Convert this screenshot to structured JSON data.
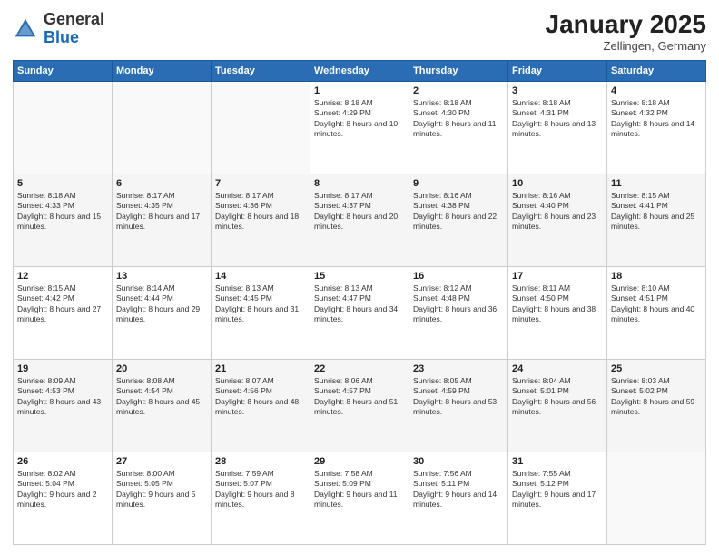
{
  "header": {
    "logo_general": "General",
    "logo_blue": "Blue",
    "title": "January 2025",
    "subtitle": "Zellingen, Germany"
  },
  "weekdays": [
    "Sunday",
    "Monday",
    "Tuesday",
    "Wednesday",
    "Thursday",
    "Friday",
    "Saturday"
  ],
  "weeks": [
    [
      {
        "day": "",
        "sunrise": "",
        "sunset": "",
        "daylight": ""
      },
      {
        "day": "",
        "sunrise": "",
        "sunset": "",
        "daylight": ""
      },
      {
        "day": "",
        "sunrise": "",
        "sunset": "",
        "daylight": ""
      },
      {
        "day": "1",
        "sunrise": "Sunrise: 8:18 AM",
        "sunset": "Sunset: 4:29 PM",
        "daylight": "Daylight: 8 hours and 10 minutes."
      },
      {
        "day": "2",
        "sunrise": "Sunrise: 8:18 AM",
        "sunset": "Sunset: 4:30 PM",
        "daylight": "Daylight: 8 hours and 11 minutes."
      },
      {
        "day": "3",
        "sunrise": "Sunrise: 8:18 AM",
        "sunset": "Sunset: 4:31 PM",
        "daylight": "Daylight: 8 hours and 13 minutes."
      },
      {
        "day": "4",
        "sunrise": "Sunrise: 8:18 AM",
        "sunset": "Sunset: 4:32 PM",
        "daylight": "Daylight: 8 hours and 14 minutes."
      }
    ],
    [
      {
        "day": "5",
        "sunrise": "Sunrise: 8:18 AM",
        "sunset": "Sunset: 4:33 PM",
        "daylight": "Daylight: 8 hours and 15 minutes."
      },
      {
        "day": "6",
        "sunrise": "Sunrise: 8:17 AM",
        "sunset": "Sunset: 4:35 PM",
        "daylight": "Daylight: 8 hours and 17 minutes."
      },
      {
        "day": "7",
        "sunrise": "Sunrise: 8:17 AM",
        "sunset": "Sunset: 4:36 PM",
        "daylight": "Daylight: 8 hours and 18 minutes."
      },
      {
        "day": "8",
        "sunrise": "Sunrise: 8:17 AM",
        "sunset": "Sunset: 4:37 PM",
        "daylight": "Daylight: 8 hours and 20 minutes."
      },
      {
        "day": "9",
        "sunrise": "Sunrise: 8:16 AM",
        "sunset": "Sunset: 4:38 PM",
        "daylight": "Daylight: 8 hours and 22 minutes."
      },
      {
        "day": "10",
        "sunrise": "Sunrise: 8:16 AM",
        "sunset": "Sunset: 4:40 PM",
        "daylight": "Daylight: 8 hours and 23 minutes."
      },
      {
        "day": "11",
        "sunrise": "Sunrise: 8:15 AM",
        "sunset": "Sunset: 4:41 PM",
        "daylight": "Daylight: 8 hours and 25 minutes."
      }
    ],
    [
      {
        "day": "12",
        "sunrise": "Sunrise: 8:15 AM",
        "sunset": "Sunset: 4:42 PM",
        "daylight": "Daylight: 8 hours and 27 minutes."
      },
      {
        "day": "13",
        "sunrise": "Sunrise: 8:14 AM",
        "sunset": "Sunset: 4:44 PM",
        "daylight": "Daylight: 8 hours and 29 minutes."
      },
      {
        "day": "14",
        "sunrise": "Sunrise: 8:13 AM",
        "sunset": "Sunset: 4:45 PM",
        "daylight": "Daylight: 8 hours and 31 minutes."
      },
      {
        "day": "15",
        "sunrise": "Sunrise: 8:13 AM",
        "sunset": "Sunset: 4:47 PM",
        "daylight": "Daylight: 8 hours and 34 minutes."
      },
      {
        "day": "16",
        "sunrise": "Sunrise: 8:12 AM",
        "sunset": "Sunset: 4:48 PM",
        "daylight": "Daylight: 8 hours and 36 minutes."
      },
      {
        "day": "17",
        "sunrise": "Sunrise: 8:11 AM",
        "sunset": "Sunset: 4:50 PM",
        "daylight": "Daylight: 8 hours and 38 minutes."
      },
      {
        "day": "18",
        "sunrise": "Sunrise: 8:10 AM",
        "sunset": "Sunset: 4:51 PM",
        "daylight": "Daylight: 8 hours and 40 minutes."
      }
    ],
    [
      {
        "day": "19",
        "sunrise": "Sunrise: 8:09 AM",
        "sunset": "Sunset: 4:53 PM",
        "daylight": "Daylight: 8 hours and 43 minutes."
      },
      {
        "day": "20",
        "sunrise": "Sunrise: 8:08 AM",
        "sunset": "Sunset: 4:54 PM",
        "daylight": "Daylight: 8 hours and 45 minutes."
      },
      {
        "day": "21",
        "sunrise": "Sunrise: 8:07 AM",
        "sunset": "Sunset: 4:56 PM",
        "daylight": "Daylight: 8 hours and 48 minutes."
      },
      {
        "day": "22",
        "sunrise": "Sunrise: 8:06 AM",
        "sunset": "Sunset: 4:57 PM",
        "daylight": "Daylight: 8 hours and 51 minutes."
      },
      {
        "day": "23",
        "sunrise": "Sunrise: 8:05 AM",
        "sunset": "Sunset: 4:59 PM",
        "daylight": "Daylight: 8 hours and 53 minutes."
      },
      {
        "day": "24",
        "sunrise": "Sunrise: 8:04 AM",
        "sunset": "Sunset: 5:01 PM",
        "daylight": "Daylight: 8 hours and 56 minutes."
      },
      {
        "day": "25",
        "sunrise": "Sunrise: 8:03 AM",
        "sunset": "Sunset: 5:02 PM",
        "daylight": "Daylight: 8 hours and 59 minutes."
      }
    ],
    [
      {
        "day": "26",
        "sunrise": "Sunrise: 8:02 AM",
        "sunset": "Sunset: 5:04 PM",
        "daylight": "Daylight: 9 hours and 2 minutes."
      },
      {
        "day": "27",
        "sunrise": "Sunrise: 8:00 AM",
        "sunset": "Sunset: 5:05 PM",
        "daylight": "Daylight: 9 hours and 5 minutes."
      },
      {
        "day": "28",
        "sunrise": "Sunrise: 7:59 AM",
        "sunset": "Sunset: 5:07 PM",
        "daylight": "Daylight: 9 hours and 8 minutes."
      },
      {
        "day": "29",
        "sunrise": "Sunrise: 7:58 AM",
        "sunset": "Sunset: 5:09 PM",
        "daylight": "Daylight: 9 hours and 11 minutes."
      },
      {
        "day": "30",
        "sunrise": "Sunrise: 7:56 AM",
        "sunset": "Sunset: 5:11 PM",
        "daylight": "Daylight: 9 hours and 14 minutes."
      },
      {
        "day": "31",
        "sunrise": "Sunrise: 7:55 AM",
        "sunset": "Sunset: 5:12 PM",
        "daylight": "Daylight: 9 hours and 17 minutes."
      },
      {
        "day": "",
        "sunrise": "",
        "sunset": "",
        "daylight": ""
      }
    ]
  ]
}
